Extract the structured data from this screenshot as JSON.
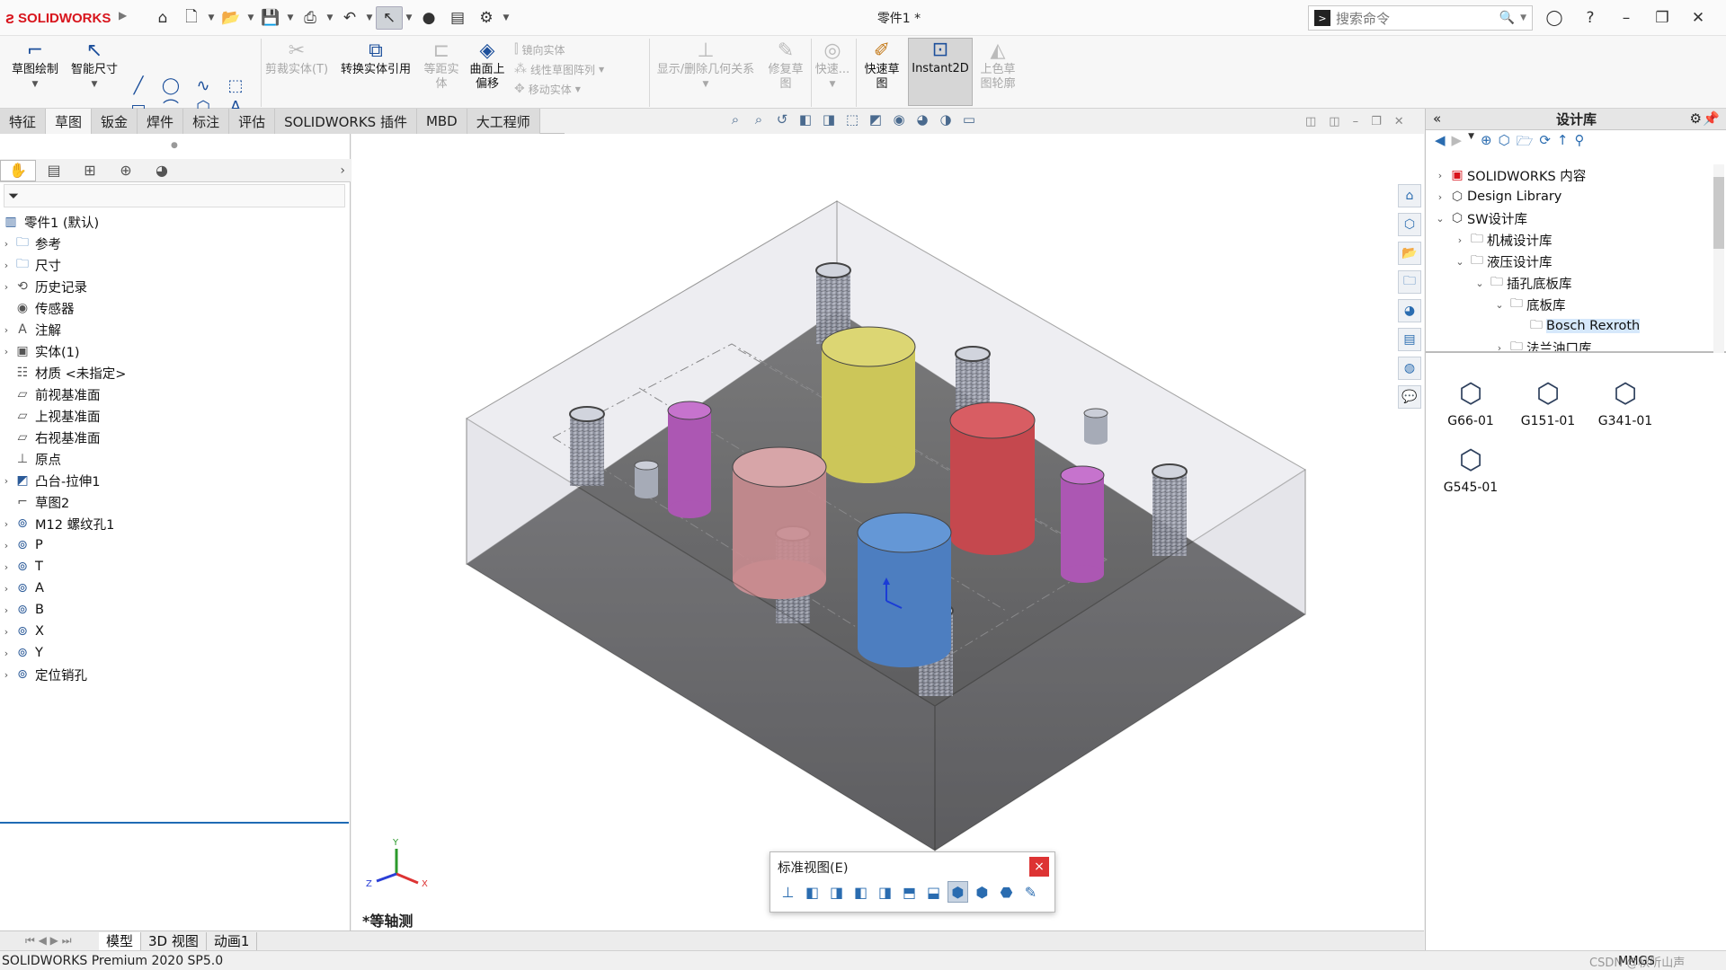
{
  "app": {
    "brand": "SOLIDWORKS",
    "title": "零件1 *",
    "search_placeholder": "搜索命令"
  },
  "ribbon": {
    "sketch": "草图绘制",
    "smart_dim": "智能尺寸",
    "trim": "剪裁实体(T)",
    "convert": "转换实体引用",
    "offset_entity_1": "等距实",
    "offset_entity_2": "体",
    "surface_offset_1": "曲面上",
    "surface_offset_2": "偏移",
    "mirror": "镜向实体",
    "linear_pattern": "线性草图阵列",
    "move": "移动实体",
    "relations": "显示/删除几何关系",
    "repair_1": "修复草",
    "repair_2": "图",
    "quick_1": "快速...",
    "rapid_1": "快速草",
    "rapid_2": "图",
    "instant2d": "Instant2D",
    "shaded_1": "上色草",
    "shaded_2": "图轮廓"
  },
  "tabs": [
    "特征",
    "草图",
    "钣金",
    "焊件",
    "标注",
    "评估",
    "SOLIDWORKS 插件",
    "MBD",
    "大工程师"
  ],
  "tree": {
    "root": "零件1 (默认)",
    "items": [
      {
        "label": "参考",
        "icon": "folder-icon",
        "caret": "›"
      },
      {
        "label": "尺寸",
        "icon": "folder-icon",
        "caret": "›"
      },
      {
        "label": "历史记录",
        "icon": "history-icon",
        "caret": "›"
      },
      {
        "label": "传感器",
        "icon": "sensor-icon",
        "caret": ""
      },
      {
        "label": "注解",
        "icon": "annotation-icon",
        "caret": "›"
      },
      {
        "label": "实体(1)",
        "icon": "solid-body-icon",
        "caret": "›"
      },
      {
        "label": "材质 <未指定>",
        "icon": "material-icon",
        "caret": ""
      },
      {
        "label": "前视基准面",
        "icon": "plane-icon",
        "caret": ""
      },
      {
        "label": "上视基准面",
        "icon": "plane-icon",
        "caret": ""
      },
      {
        "label": "右视基准面",
        "icon": "plane-icon",
        "caret": ""
      },
      {
        "label": "原点",
        "icon": "origin-icon",
        "caret": ""
      },
      {
        "label": "凸台-拉伸1",
        "icon": "extrude-icon",
        "caret": "›"
      },
      {
        "label": "草图2",
        "icon": "sketch-icon",
        "caret": ""
      },
      {
        "label": "M12 螺纹孔1",
        "icon": "hole-icon",
        "caret": "›"
      },
      {
        "label": "P",
        "icon": "hole-icon",
        "caret": "›"
      },
      {
        "label": "T",
        "icon": "hole-icon",
        "caret": "›"
      },
      {
        "label": "A",
        "icon": "hole-icon",
        "caret": "›"
      },
      {
        "label": "B",
        "icon": "hole-icon",
        "caret": "›"
      },
      {
        "label": "X",
        "icon": "hole-icon",
        "caret": "›"
      },
      {
        "label": "Y",
        "icon": "hole-icon",
        "caret": "›"
      },
      {
        "label": "定位销孔",
        "icon": "hole-icon",
        "caret": "›"
      }
    ]
  },
  "design_library": {
    "title": "设计库",
    "items": [
      {
        "label": "SOLIDWORKS 内容",
        "caret": "›",
        "indent": 0,
        "icon": "sw-content-icon"
      },
      {
        "label": "Design Library",
        "caret": "›",
        "indent": 0,
        "icon": "library-icon"
      },
      {
        "label": "SW设计库",
        "caret": "⌄",
        "indent": 0,
        "icon": "library-icon"
      },
      {
        "label": "机械设计库",
        "caret": "›",
        "indent": 1,
        "icon": "folder-icon"
      },
      {
        "label": "液压设计库",
        "caret": "⌄",
        "indent": 1,
        "icon": "folder-icon"
      },
      {
        "label": "插孔底板库",
        "caret": "⌄",
        "indent": 2,
        "icon": "folder-icon"
      },
      {
        "label": "底板库",
        "caret": "⌄",
        "indent": 3,
        "icon": "folder-icon"
      },
      {
        "label": "Bosch Rexroth",
        "caret": "",
        "indent": 4,
        "icon": "folder-icon",
        "selected": true
      },
      {
        "label": "法兰油口库",
        "caret": "›",
        "indent": 3,
        "icon": "folder-icon"
      }
    ],
    "parts": [
      "G66-01",
      "G151-01",
      "G341-01",
      "G545-01"
    ]
  },
  "standard_views": {
    "title": "标准视图(E)",
    "close": "×"
  },
  "view_name": "*等轴测",
  "triad": {
    "x": "X",
    "y": "Y",
    "z": "Z"
  },
  "bottom_tabs": [
    "模型",
    "3D 视图",
    "动画1"
  ],
  "status": {
    "left": "SOLIDWORKS Premium 2020 SP5.0",
    "units": "MMGS",
    "watermark": "CSDN @秋听山声"
  },
  "colors": {
    "brand": "#d8141c",
    "accent": "#2a6cb0",
    "yellow_cyl": "#c9c23a",
    "red_cyl": "#c0272d",
    "pink_cyl": "#c47a7d",
    "blue_cyl": "#2e6ab8",
    "magenta_cyl": "#a23aa8"
  }
}
